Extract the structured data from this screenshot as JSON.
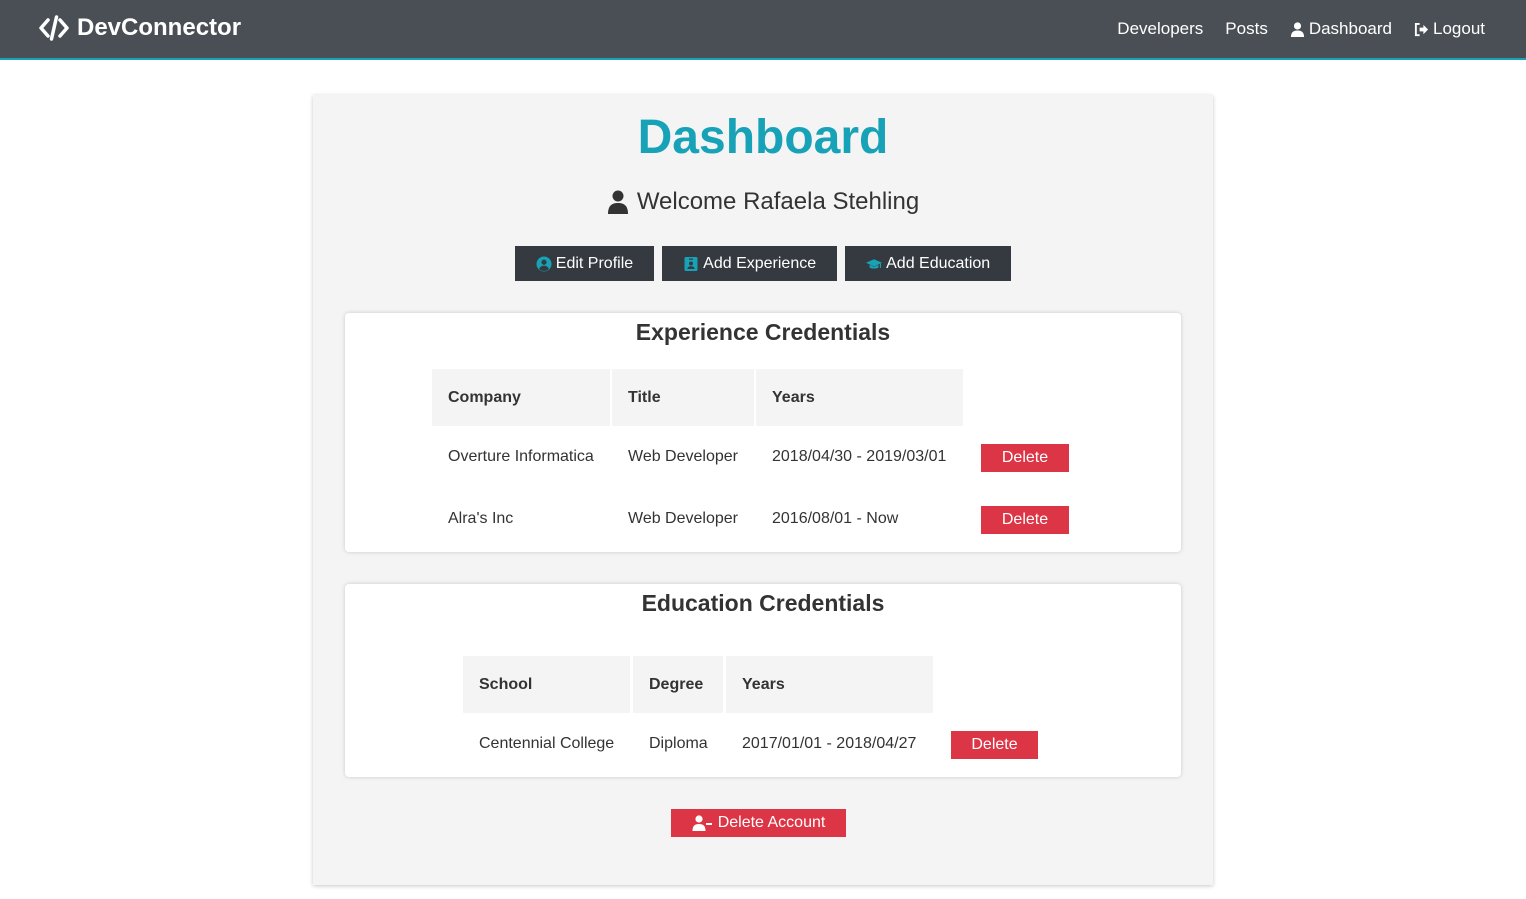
{
  "navbar": {
    "brand": "DevConnector",
    "links": [
      {
        "label": "Developers",
        "icon": null
      },
      {
        "label": "Posts",
        "icon": null
      },
      {
        "label": "Dashboard",
        "icon": "user-icon"
      },
      {
        "label": "Logout",
        "icon": "sign-out-icon"
      }
    ]
  },
  "page": {
    "title": "Dashboard",
    "welcome": "Welcome Rafaela Stehling"
  },
  "actions": {
    "edit_profile": "Edit Profile",
    "add_experience": "Add Experience",
    "add_education": "Add Education"
  },
  "experience": {
    "title": "Experience Credentials",
    "headers": [
      "Company",
      "Title",
      "Years"
    ],
    "rows": [
      {
        "company": "Overture Informatica",
        "title": "Web Developer",
        "years": "2018/04/30 - 2019/03/01",
        "delete": "Delete"
      },
      {
        "company": "Alra's Inc",
        "title": "Web Developer",
        "years": "2016/08/01 - Now",
        "delete": "Delete"
      }
    ]
  },
  "education": {
    "title": "Education Credentials",
    "headers": [
      "School",
      "Degree",
      "Years"
    ],
    "rows": [
      {
        "school": "Centennial College",
        "degree": "Diploma",
        "years": "2017/01/01 - 2018/04/27",
        "delete": "Delete"
      }
    ]
  },
  "delete_account": "Delete Account",
  "colors": {
    "primary": "#17a2b8",
    "dark": "#343a40",
    "danger": "#dc3545",
    "navbar": "#4a4e55",
    "light": "#f4f4f4"
  }
}
